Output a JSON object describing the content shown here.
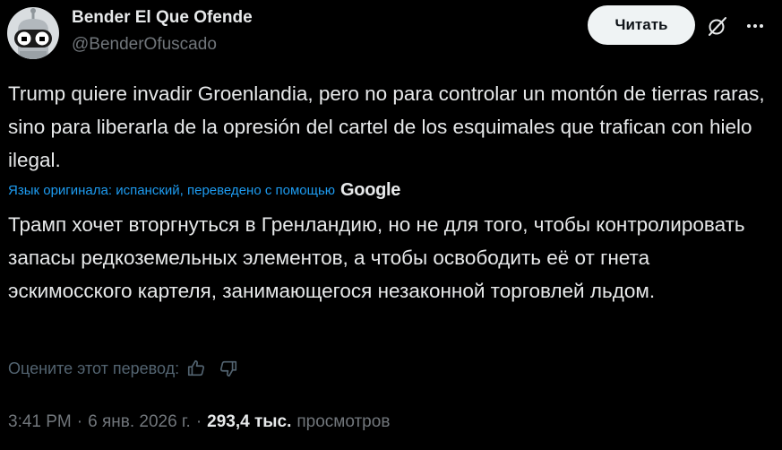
{
  "author": {
    "display_name": "Bender El Que Ofende",
    "handle": "@BenderOfuscado"
  },
  "actions": {
    "read_label": "Читать",
    "grok_icon": "grok-slash-icon",
    "more_icon": "more-dots-icon"
  },
  "tweet": {
    "text": "Trump quiere invadir Groenlandia, pero no para controlar un montón de tierras raras, sino para liberarla de la opresión del cartel de los esquimales que trafican con hielo ilegal."
  },
  "translation": {
    "label": "Язык оригинала: испанский, переведено с помощью",
    "provider": "Google",
    "text": "Трамп хочет вторгнуться в Гренландию, но не для того, чтобы контролировать запасы редкоземельных элементов, а чтобы освободить её от гнета эскимосского картеля, занимающегося незаконной торговлей льдом.",
    "rate_label": "Оцените этот перевод:"
  },
  "meta": {
    "time": "3:41 PM",
    "separator": "·",
    "date": "6 янв. 2026 г.",
    "views_count": "293,4 тыс.",
    "views_label": "просмотров"
  },
  "colors": {
    "background": "#000000",
    "text": "#e7e9ea",
    "secondary": "#71767b",
    "link": "#1d9bf0",
    "button_bg": "#eff3f4"
  }
}
